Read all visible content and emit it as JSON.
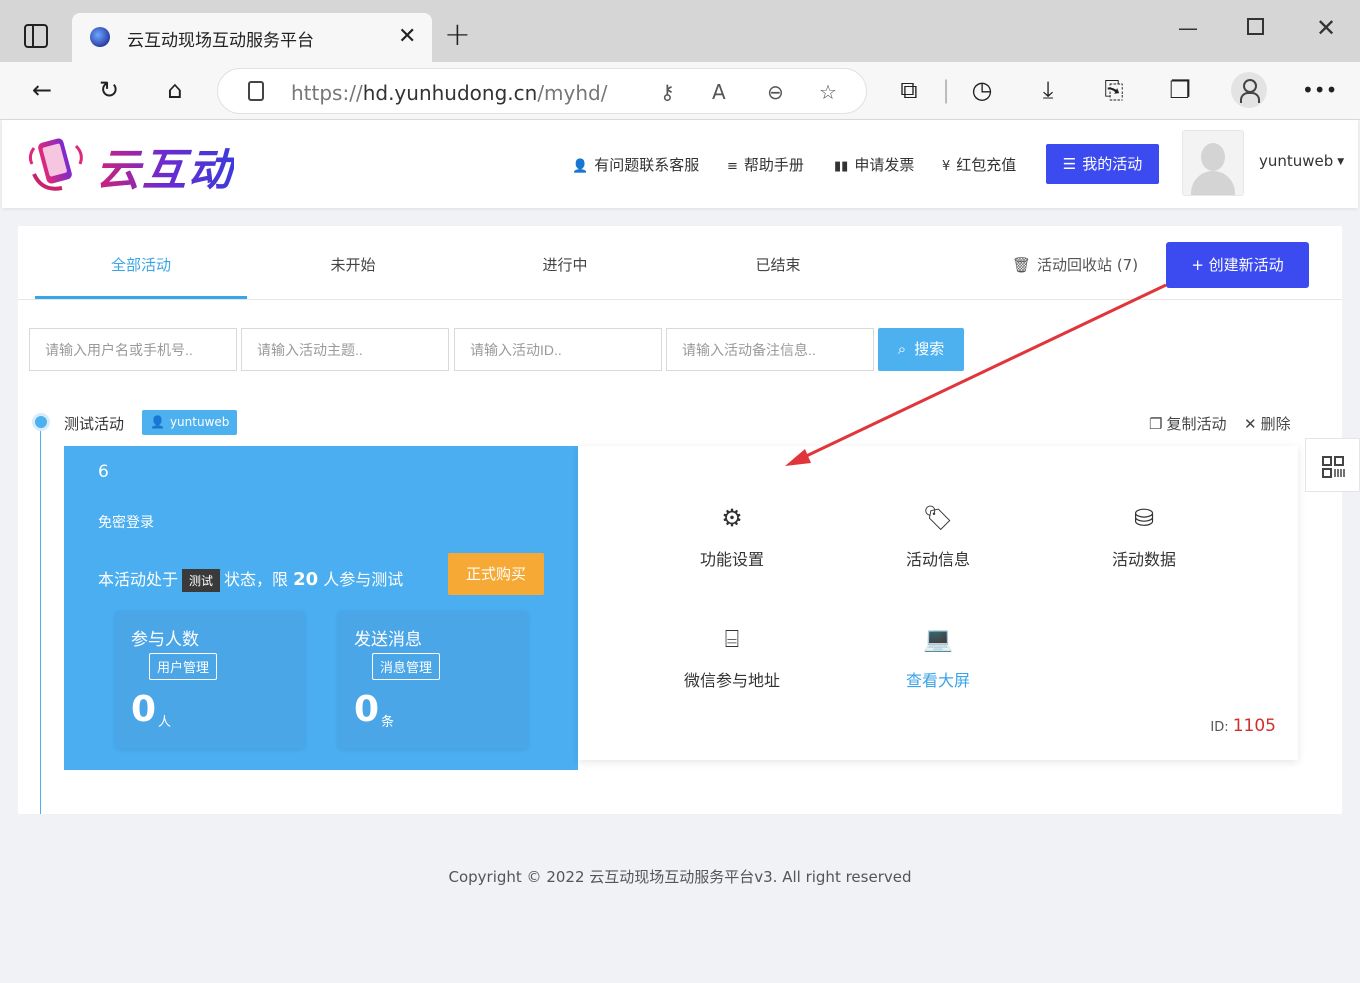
{
  "browser": {
    "tab_title": "云互动现场互动服务平台",
    "url_prefix": "https://",
    "url_host": "hd.yunhudong.cn",
    "url_path": "/myhd/"
  },
  "header": {
    "logo_text": "云互动",
    "nav": [
      "有问题联系客服",
      "帮助手册",
      "申请发票",
      "红包充值"
    ],
    "my_activity": "我的活动",
    "username": "yuntuweb"
  },
  "tabs": [
    "全部活动",
    "未开始",
    "进行中",
    "已结束"
  ],
  "recycle": "活动回收站 (7)",
  "create_button": "+ 创建新活动",
  "search": {
    "placeholders": [
      "请输入用户名或手机号..",
      "请输入活动主题..",
      "请输入活动ID..",
      "请输入活动备注信息.."
    ],
    "button": "搜索"
  },
  "activity": {
    "name": "测试活动",
    "owner": "yuntuweb",
    "copy": "复制活动",
    "delete": "删除",
    "number": "6",
    "login_mode": "免密登录",
    "status_prefix": "本活动处于",
    "status_badge": "测试",
    "status_mid": "状态，限",
    "limit": "20",
    "status_suffix": "人参与测试",
    "buy_button": "正式购买",
    "stats": [
      {
        "title": "参与人数",
        "link": "用户管理",
        "value": "0",
        "unit": "人"
      },
      {
        "title": "发送消息",
        "link": "消息管理",
        "value": "0",
        "unit": "条"
      }
    ],
    "functions": [
      "功能设置",
      "活动信息",
      "活动数据",
      "微信参与地址",
      "查看大屏"
    ],
    "id_label": "ID:",
    "id_value": "1105"
  },
  "footer": "Copyright © 2022 云互动现场互动服务平台v3. All right reserved",
  "colors": {
    "primary": "#3b4bf0",
    "accent": "#4db0ef",
    "orange": "#f6a935",
    "arrow": "#e0353a"
  }
}
